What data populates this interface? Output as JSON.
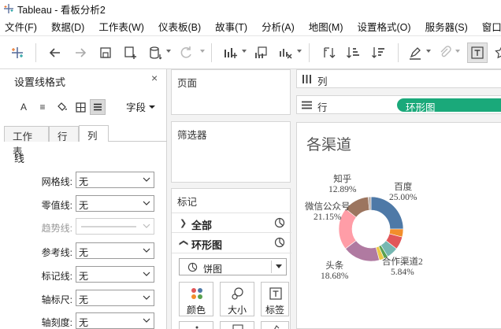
{
  "app": {
    "title": "Tableau - 看板分析2"
  },
  "menu": {
    "items": [
      "文件(F)",
      "数据(D)",
      "工作表(W)",
      "仪表板(B)",
      "故事(T)",
      "分析(A)",
      "地图(M)",
      "设置格式(O)",
      "服务器(S)",
      "窗口(N)"
    ]
  },
  "format_pane": {
    "title": "设置线格式",
    "close": "×",
    "tools": {
      "font": "A",
      "align": "≡"
    },
    "field_label": "字段",
    "tabs": [
      "工作表",
      "行",
      "列"
    ],
    "active_tab": "列",
    "section": "线",
    "rows": [
      {
        "label": "网格线:",
        "value": "无"
      },
      {
        "label": "零值线:",
        "value": "无"
      },
      {
        "label": "趋势线:",
        "value": ""
      },
      {
        "label": "参考线:",
        "value": "无"
      },
      {
        "label": "标记线:",
        "value": "无"
      },
      {
        "label": "轴标尺:",
        "value": "无"
      },
      {
        "label": "轴刻度:",
        "value": "无"
      }
    ]
  },
  "shelves": {
    "pages": "页面",
    "filters": "筛选器",
    "marks": "标记",
    "marks_all": "全部",
    "marks_layer": "环形图",
    "mark_type": "饼图",
    "buttons": {
      "color": "颜色",
      "size": "大小",
      "label": "标签"
    },
    "columns": "列",
    "rows": "行",
    "rows_pill": "环形图"
  },
  "view": {
    "title": "各渠道"
  },
  "colors": {
    "pill": "#1aa97a",
    "accent": "#4e79a7"
  },
  "chart_data": {
    "type": "pie",
    "title": "各渠道",
    "donut": true,
    "slices": [
      {
        "name": "百度",
        "percent": 25.0,
        "label_percent": "25.00%",
        "color": "#4e79a7"
      },
      {
        "name": "",
        "percent": 4.0,
        "label_percent": "",
        "color": "#f28e2b"
      },
      {
        "name": "",
        "percent": 6.5,
        "label_percent": "",
        "color": "#e15759"
      },
      {
        "name": "合作渠道2",
        "percent": 5.84,
        "label_percent": "5.84%",
        "color": "#76b7b2"
      },
      {
        "name": "",
        "percent": 2.0,
        "label_percent": "",
        "color": "#59a14f"
      },
      {
        "name": "",
        "percent": 2.52,
        "label_percent": "",
        "color": "#edc948"
      },
      {
        "name": "头条",
        "percent": 18.68,
        "label_percent": "18.68%",
        "color": "#b07aa1"
      },
      {
        "name": "微信公众号",
        "percent": 21.15,
        "label_percent": "21.15%",
        "color": "#ff9da7"
      },
      {
        "name": "知乎",
        "percent": 12.89,
        "label_percent": "12.89%",
        "color": "#9c755f"
      },
      {
        "name": "",
        "percent": 1.42,
        "label_percent": "",
        "color": "#bab0ac"
      }
    ]
  }
}
